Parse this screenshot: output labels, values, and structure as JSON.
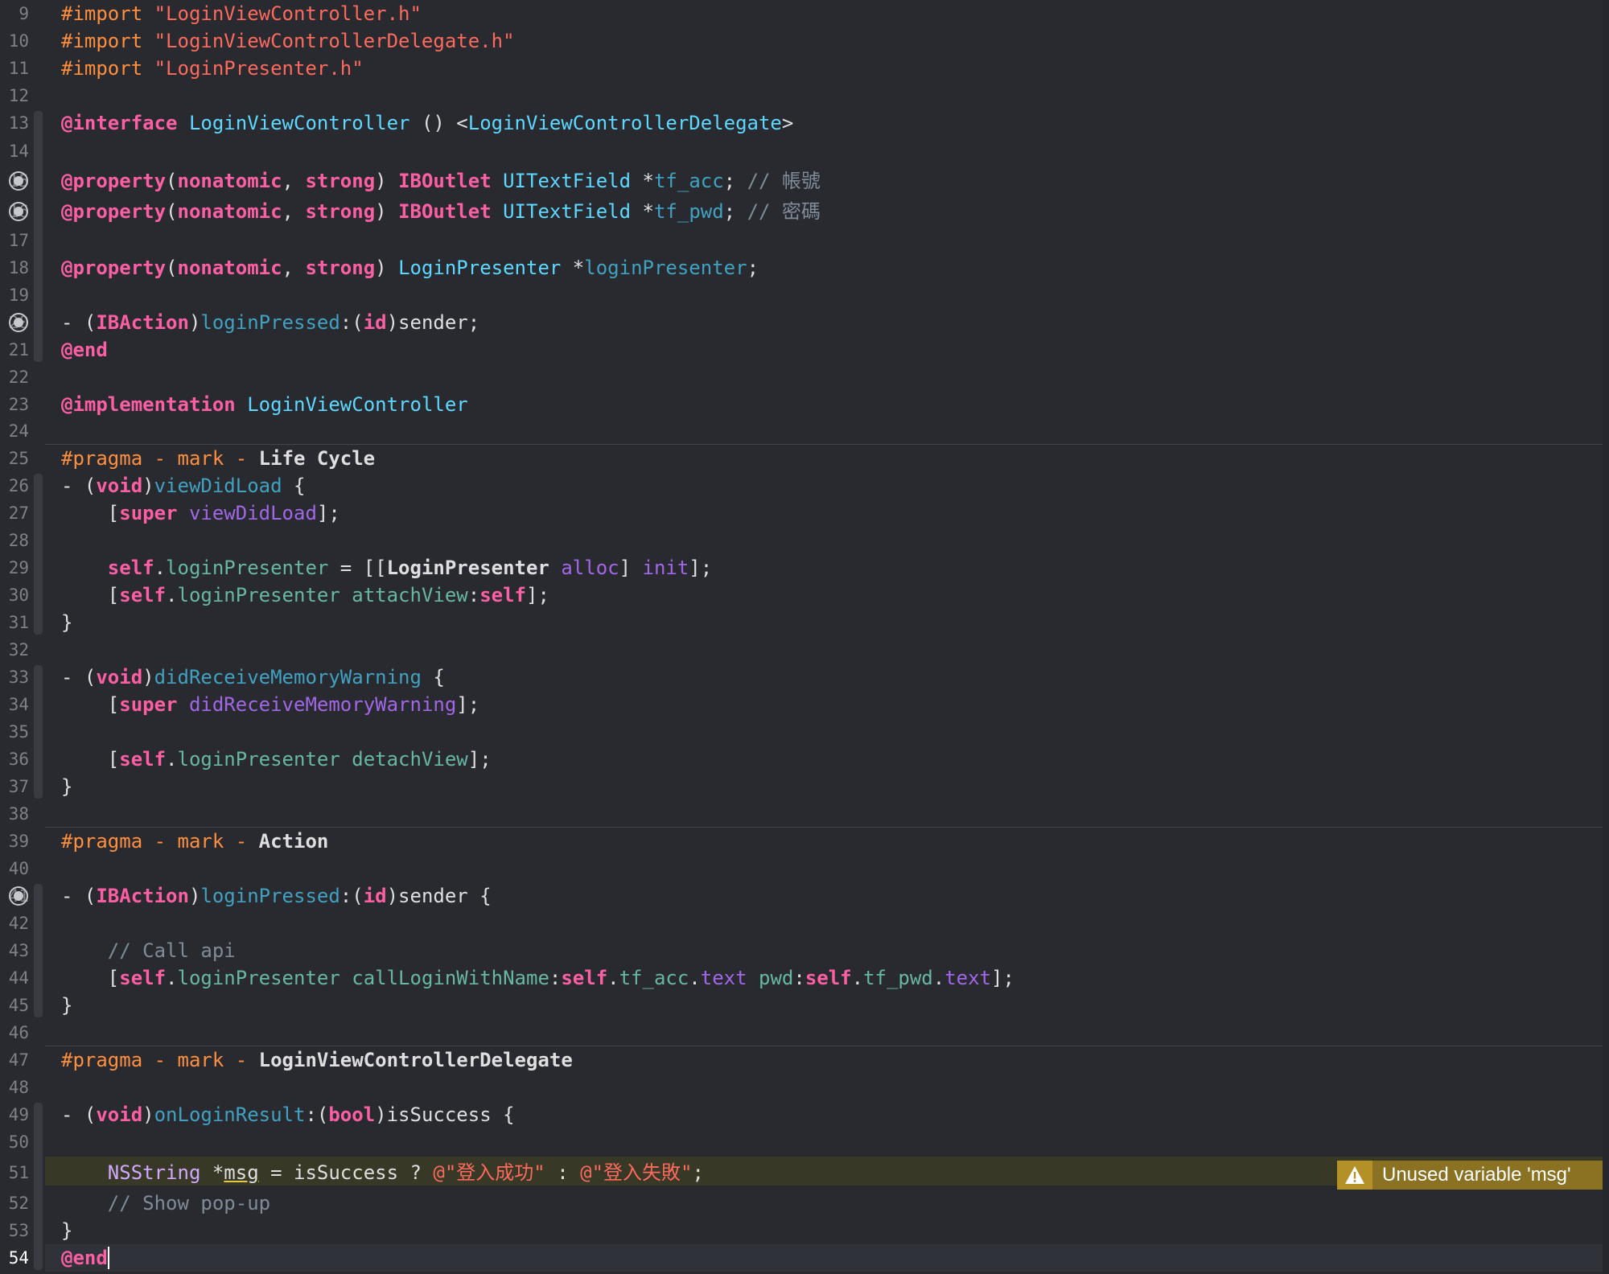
{
  "editor": {
    "language": "Objective-C",
    "current_line": 54,
    "warning": {
      "line": 51,
      "text": "Unused variable 'msg'",
      "icon": "warning-triangle-icon"
    },
    "breakpoint_lines": [
      15,
      16,
      20,
      41
    ],
    "colors": {
      "background": "#292a30",
      "keyword": "#fc5fa3",
      "preprocessor": "#fd8f3f",
      "string": "#fc6a5d",
      "comment": "#7f8c98",
      "class_name": "#5dd8ff",
      "property": "#41a1c0",
      "method_call": "#67b7a4",
      "warning_badge": "#8a7222"
    },
    "lines": [
      {
        "n": "9",
        "text": "#import \"LoginViewController.h\""
      },
      {
        "n": "10",
        "text": "#import \"LoginViewControllerDelegate.h\""
      },
      {
        "n": "11",
        "text": "#import \"LoginPresenter.h\""
      },
      {
        "n": "12",
        "text": ""
      },
      {
        "n": "13",
        "text": "@interface LoginViewController () <LoginViewControllerDelegate>"
      },
      {
        "n": "14",
        "text": ""
      },
      {
        "n": "15",
        "text": "@property(nonatomic, strong) IBOutlet UITextField *tf_acc; // 帳號"
      },
      {
        "n": "16",
        "text": "@property(nonatomic, strong) IBOutlet UITextField *tf_pwd; // 密碼"
      },
      {
        "n": "17",
        "text": ""
      },
      {
        "n": "18",
        "text": "@property(nonatomic, strong) LoginPresenter *loginPresenter;"
      },
      {
        "n": "19",
        "text": ""
      },
      {
        "n": "20",
        "text": "- (IBAction)loginPressed:(id)sender;"
      },
      {
        "n": "21",
        "text": "@end"
      },
      {
        "n": "22",
        "text": ""
      },
      {
        "n": "23",
        "text": "@implementation LoginViewController"
      },
      {
        "n": "24",
        "text": ""
      },
      {
        "n": "25",
        "text": "#pragma - mark - Life Cycle"
      },
      {
        "n": "26",
        "text": "- (void)viewDidLoad {"
      },
      {
        "n": "27",
        "text": "    [super viewDidLoad];"
      },
      {
        "n": "28",
        "text": ""
      },
      {
        "n": "29",
        "text": "    self.loginPresenter = [[LoginPresenter alloc] init];"
      },
      {
        "n": "30",
        "text": "    [self.loginPresenter attachView:self];"
      },
      {
        "n": "31",
        "text": "}"
      },
      {
        "n": "32",
        "text": ""
      },
      {
        "n": "33",
        "text": "- (void)didReceiveMemoryWarning {"
      },
      {
        "n": "34",
        "text": "    [super didReceiveMemoryWarning];"
      },
      {
        "n": "35",
        "text": ""
      },
      {
        "n": "36",
        "text": "    [self.loginPresenter detachView];"
      },
      {
        "n": "37",
        "text": "}"
      },
      {
        "n": "38",
        "text": ""
      },
      {
        "n": "39",
        "text": "#pragma - mark - Action"
      },
      {
        "n": "40",
        "text": ""
      },
      {
        "n": "41",
        "text": "- (IBAction)loginPressed:(id)sender {"
      },
      {
        "n": "42",
        "text": ""
      },
      {
        "n": "43",
        "text": "    // Call api"
      },
      {
        "n": "44",
        "text": "    [self.loginPresenter callLoginWithName:self.tf_acc.text pwd:self.tf_pwd.text];"
      },
      {
        "n": "45",
        "text": "}"
      },
      {
        "n": "46",
        "text": ""
      },
      {
        "n": "47",
        "text": "#pragma - mark - LoginViewControllerDelegate"
      },
      {
        "n": "48",
        "text": ""
      },
      {
        "n": "49",
        "text": "- (void)onLoginResult:(bool)isSuccess {"
      },
      {
        "n": "50",
        "text": ""
      },
      {
        "n": "51",
        "text": "    NSString *msg = isSuccess ? @\"登入成功\" : @\"登入失敗\";"
      },
      {
        "n": "52",
        "text": "    // Show pop-up"
      },
      {
        "n": "53",
        "text": "}"
      },
      {
        "n": "54",
        "text": "@end"
      }
    ]
  }
}
